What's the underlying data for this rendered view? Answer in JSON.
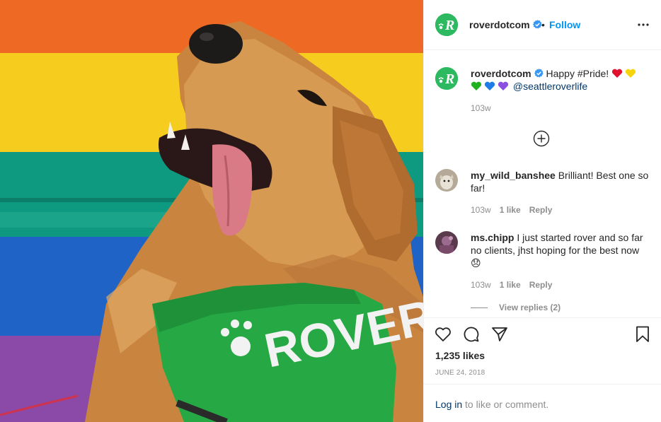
{
  "post": {
    "account": "roverdotcom",
    "follow_label": "Follow",
    "separator": "•",
    "caption": {
      "username": "roverdotcom",
      "text": "Happy #Pride!",
      "mention": "@seattleroverlife",
      "time": "103w"
    },
    "comments": [
      {
        "username": "my_wild_banshee",
        "text": "Brilliant! Best one so far!",
        "time": "103w",
        "likes": "1 like",
        "reply_label": "Reply"
      },
      {
        "username": "ms.chipp",
        "text": "I just started rover and so far no clients, jhst hoping for the best now",
        "emoji": "😞",
        "time": "103w",
        "likes": "1 like",
        "reply_label": "Reply",
        "view_replies": "View replies (2)"
      }
    ],
    "likes_count": "1,235 likes",
    "date": "JUNE 24, 2018"
  },
  "image": {
    "bandana_text": "ROVER"
  },
  "login": {
    "link": "Log in",
    "rest": "to like or comment."
  },
  "colors": {
    "brand_green": "#2cb960",
    "link_blue": "#0095f6",
    "mention_blue": "#00376b",
    "muted": "#8e8e8e"
  },
  "icons": [
    "rover-logo-icon",
    "verified-badge-icon",
    "more-options-icon",
    "add-comment-icon",
    "heart-icon",
    "comment-icon",
    "share-icon",
    "bookmark-icon"
  ]
}
